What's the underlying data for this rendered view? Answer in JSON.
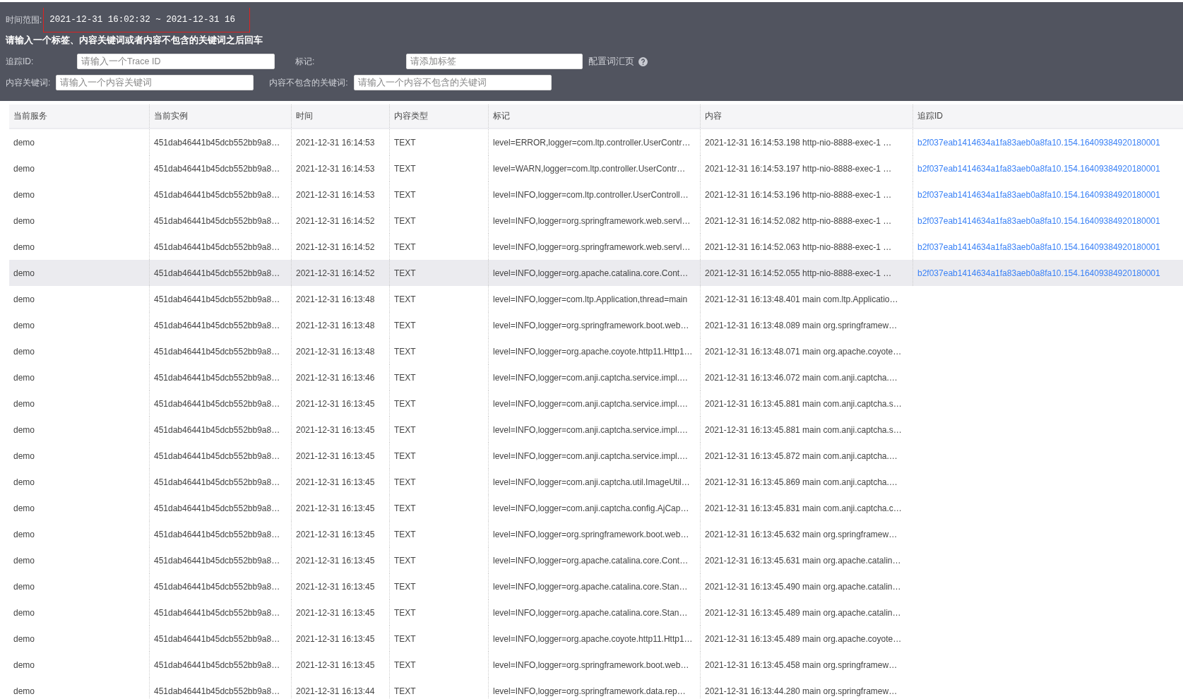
{
  "filters": {
    "time_range": {
      "label": "时间范围:",
      "value": "2021-12-31 16:02:32 ~ 2021-12-31 16"
    },
    "hint": "请输入一个标签、内容关键词或者内容不包含的关键词之后回车",
    "trace_id": {
      "label": "追踪ID:",
      "placeholder": "请输入一个Trace ID"
    },
    "tags": {
      "label": "标记:",
      "placeholder": "请添加标签"
    },
    "vocabulary_link": "配置词汇页",
    "keywords": {
      "label": "内容关键词:",
      "placeholder": "请输入一个内容关键词"
    },
    "excluded_keywords": {
      "label": "内容不包含的关键词:",
      "placeholder": "请输入一个内容不包含的关键词"
    }
  },
  "table": {
    "columns": [
      "当前服务",
      "当前实例",
      "时间",
      "内容类型",
      "标记",
      "内容",
      "追踪ID"
    ],
    "rows": [
      {
        "selected": false,
        "cells": [
          "demo",
          "451dab46441b45dcb552bb9a8…",
          "2021-12-31 16:14:53",
          "TEXT",
          "level=ERROR,logger=com.ltp.controller.UserContr…",
          "2021-12-31 16:14:53.198 http-nio-8888-exec-1 …",
          "b2f037eab1414634a1fa83aeb0a8fa10.154.16409384920180001"
        ]
      },
      {
        "selected": false,
        "cells": [
          "demo",
          "451dab46441b45dcb552bb9a8…",
          "2021-12-31 16:14:53",
          "TEXT",
          "level=WARN,logger=com.ltp.controller.UserContr…",
          "2021-12-31 16:14:53.197 http-nio-8888-exec-1 …",
          "b2f037eab1414634a1fa83aeb0a8fa10.154.16409384920180001"
        ]
      },
      {
        "selected": false,
        "cells": [
          "demo",
          "451dab46441b45dcb552bb9a8…",
          "2021-12-31 16:14:53",
          "TEXT",
          "level=INFO,logger=com.ltp.controller.UserControll…",
          "2021-12-31 16:14:53.196 http-nio-8888-exec-1 …",
          "b2f037eab1414634a1fa83aeb0a8fa10.154.16409384920180001"
        ]
      },
      {
        "selected": false,
        "cells": [
          "demo",
          "451dab46441b45dcb552bb9a8…",
          "2021-12-31 16:14:52",
          "TEXT",
          "level=INFO,logger=org.springframework.web.servl…",
          "2021-12-31 16:14:52.082 http-nio-8888-exec-1 …",
          "b2f037eab1414634a1fa83aeb0a8fa10.154.16409384920180001"
        ]
      },
      {
        "selected": false,
        "cells": [
          "demo",
          "451dab46441b45dcb552bb9a8…",
          "2021-12-31 16:14:52",
          "TEXT",
          "level=INFO,logger=org.springframework.web.servl…",
          "2021-12-31 16:14:52.063 http-nio-8888-exec-1 …",
          "b2f037eab1414634a1fa83aeb0a8fa10.154.16409384920180001"
        ]
      },
      {
        "selected": true,
        "cells": [
          "demo",
          "451dab46441b45dcb552bb9a8…",
          "2021-12-31 16:14:52",
          "TEXT",
          "level=INFO,logger=org.apache.catalina.core.Cont…",
          "2021-12-31 16:14:52.055 http-nio-8888-exec-1 …",
          "b2f037eab1414634a1fa83aeb0a8fa10.154.16409384920180001"
        ]
      },
      {
        "selected": false,
        "cells": [
          "demo",
          "451dab46441b45dcb552bb9a8…",
          "2021-12-31 16:13:48",
          "TEXT",
          "level=INFO,logger=com.ltp.Application,thread=main",
          "2021-12-31 16:13:48.401 main com.ltp.Applicatio…"
        ]
      },
      {
        "selected": false,
        "cells": [
          "demo",
          "451dab46441b45dcb552bb9a8…",
          "2021-12-31 16:13:48",
          "TEXT",
          "level=INFO,logger=org.springframework.boot.web…",
          "2021-12-31 16:13:48.089 main org.springframew…"
        ]
      },
      {
        "selected": false,
        "cells": [
          "demo",
          "451dab46441b45dcb552bb9a8…",
          "2021-12-31 16:13:48",
          "TEXT",
          "level=INFO,logger=org.apache.coyote.http11.Http1…",
          "2021-12-31 16:13:48.071 main org.apache.coyote…"
        ]
      },
      {
        "selected": false,
        "cells": [
          "demo",
          "451dab46441b45dcb552bb9a8…",
          "2021-12-31 16:13:46",
          "TEXT",
          "level=INFO,logger=com.anji.captcha.service.impl.…",
          "2021-12-31 16:13:46.072 main com.anji.captcha.…"
        ]
      },
      {
        "selected": false,
        "cells": [
          "demo",
          "451dab46441b45dcb552bb9a8…",
          "2021-12-31 16:13:45",
          "TEXT",
          "level=INFO,logger=com.anji.captcha.service.impl.…",
          "2021-12-31 16:13:45.881 main com.anji.captcha.s…"
        ]
      },
      {
        "selected": false,
        "cells": [
          "demo",
          "451dab46441b45dcb552bb9a8…",
          "2021-12-31 16:13:45",
          "TEXT",
          "level=INFO,logger=com.anji.captcha.service.impl.…",
          "2021-12-31 16:13:45.881 main com.anji.captcha.s…"
        ]
      },
      {
        "selected": false,
        "cells": [
          "demo",
          "451dab46441b45dcb552bb9a8…",
          "2021-12-31 16:13:45",
          "TEXT",
          "level=INFO,logger=com.anji.captcha.service.impl.…",
          "2021-12-31 16:13:45.872 main com.anji.captcha.…"
        ]
      },
      {
        "selected": false,
        "cells": [
          "demo",
          "451dab46441b45dcb552bb9a8…",
          "2021-12-31 16:13:45",
          "TEXT",
          "level=INFO,logger=com.anji.captcha.util.ImageUtil…",
          "2021-12-31 16:13:45.869 main com.anji.captcha.…"
        ]
      },
      {
        "selected": false,
        "cells": [
          "demo",
          "451dab46441b45dcb552bb9a8…",
          "2021-12-31 16:13:45",
          "TEXT",
          "level=INFO,logger=com.anji.captcha.config.AjCap…",
          "2021-12-31 16:13:45.831 main com.anji.captcha.c…"
        ]
      },
      {
        "selected": false,
        "cells": [
          "demo",
          "451dab46441b45dcb552bb9a8…",
          "2021-12-31 16:13:45",
          "TEXT",
          "level=INFO,logger=org.springframework.boot.web…",
          "2021-12-31 16:13:45.632 main org.springframew…"
        ]
      },
      {
        "selected": false,
        "cells": [
          "demo",
          "451dab46441b45dcb552bb9a8…",
          "2021-12-31 16:13:45",
          "TEXT",
          "level=INFO,logger=org.apache.catalina.core.Cont…",
          "2021-12-31 16:13:45.631 main org.apache.catalin…"
        ]
      },
      {
        "selected": false,
        "cells": [
          "demo",
          "451dab46441b45dcb552bb9a8…",
          "2021-12-31 16:13:45",
          "TEXT",
          "level=INFO,logger=org.apache.catalina.core.Stan…",
          "2021-12-31 16:13:45.490 main org.apache.catalin…"
        ]
      },
      {
        "selected": false,
        "cells": [
          "demo",
          "451dab46441b45dcb552bb9a8…",
          "2021-12-31 16:13:45",
          "TEXT",
          "level=INFO,logger=org.apache.catalina.core.Stan…",
          "2021-12-31 16:13:45.489 main org.apache.catalin…"
        ]
      },
      {
        "selected": false,
        "cells": [
          "demo",
          "451dab46441b45dcb552bb9a8…",
          "2021-12-31 16:13:45",
          "TEXT",
          "level=INFO,logger=org.apache.coyote.http11.Http1…",
          "2021-12-31 16:13:45.489 main org.apache.coyote…"
        ]
      },
      {
        "selected": false,
        "cells": [
          "demo",
          "451dab46441b45dcb552bb9a8…",
          "2021-12-31 16:13:45",
          "TEXT",
          "level=INFO,logger=org.springframework.boot.web…",
          "2021-12-31 16:13:45.458 main org.springframew…"
        ]
      },
      {
        "selected": false,
        "cells": [
          "demo",
          "451dab46441b45dcb552bb9a8…",
          "2021-12-31 16:13:44",
          "TEXT",
          "level=INFO,logger=org.springframework.data.rep…",
          "2021-12-31 16:13:44.280 main org.springframew…"
        ]
      }
    ]
  }
}
